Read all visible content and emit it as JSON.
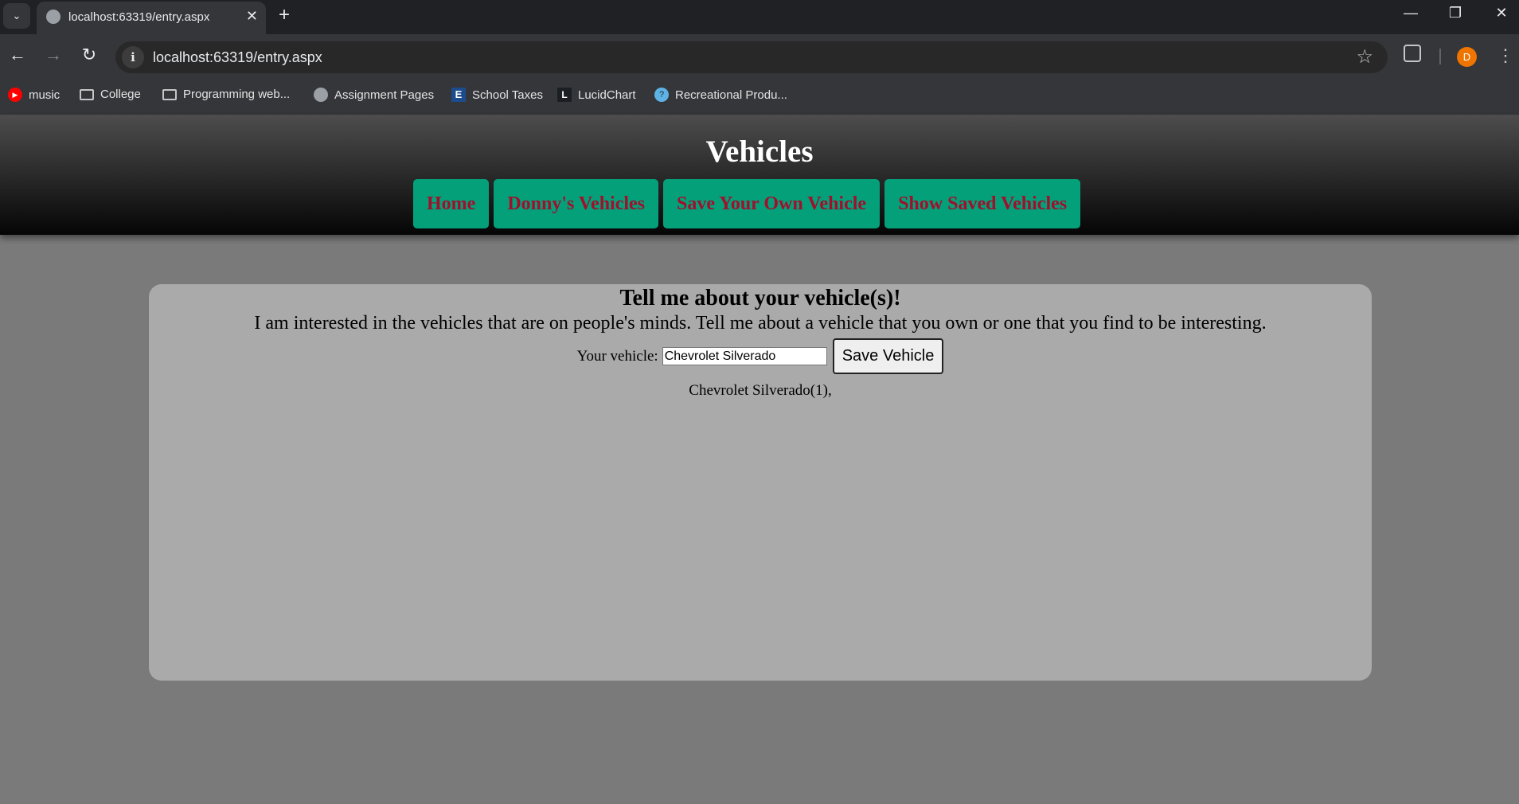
{
  "browser": {
    "tab": {
      "title": "localhost:63319/entry.aspx",
      "close": "✕"
    },
    "new_tab": "+",
    "url": "localhost:63319/entry.aspx",
    "window_controls": {
      "minimize": "—",
      "restore": "❐",
      "close": "✕"
    },
    "nav": {
      "back": "←",
      "forward": "→",
      "reload": "↻"
    },
    "info_icon": "i",
    "star_icon": "☆",
    "avatar_initial": "D",
    "menu_icon": "⋮",
    "tab_search_icon": "⌄",
    "bookmarks": [
      {
        "label": "music",
        "icon": "youtube-music-icon"
      },
      {
        "label": "College",
        "icon": "folder-icon"
      },
      {
        "label": "Programming web...",
        "icon": "folder-icon"
      },
      {
        "label": "Assignment Pages",
        "icon": "globe-icon"
      },
      {
        "label": "School Taxes",
        "icon": "edu-e-icon"
      },
      {
        "label": "LucidChart",
        "icon": "lucidchart-icon"
      },
      {
        "label": "Recreational Produ...",
        "icon": "recreation-icon"
      }
    ]
  },
  "site": {
    "title": "Vehicles",
    "nav": [
      "Home",
      "Donny's Vehicles",
      "Save Your Own Vehicle",
      "Show Saved Vehicles"
    ],
    "colors": {
      "nav_bg": "#04a07a",
      "nav_text": "#a0102c",
      "panel_bg": "#aaaaaa",
      "page_bg": "#7a7a7a"
    }
  },
  "form": {
    "heading": "Tell me about your vehicle(s)!",
    "intro": "I am interested in the vehicles that are on people's minds. Tell me about a vehicle that you own or one that you find to be interesting.",
    "label": "Your vehicle:",
    "input_value": "Chevrolet Silverado",
    "button": "Save Vehicle",
    "result": "Chevrolet Silverado(1),"
  }
}
